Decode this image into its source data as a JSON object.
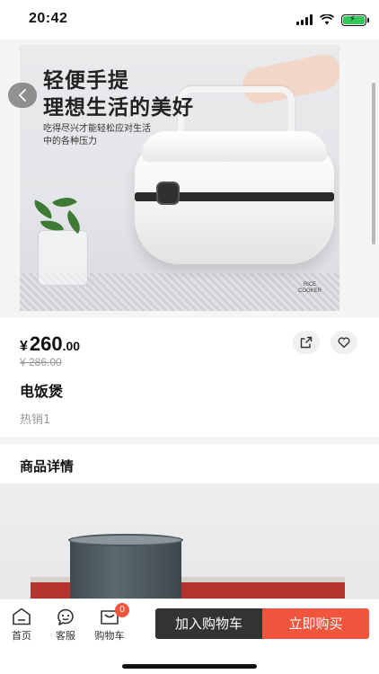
{
  "status_bar": {
    "time": "20:42"
  },
  "hero": {
    "title_line1": "轻便手提",
    "title_line2": "理想生活的美好",
    "subtitle_line1": "吃得尽兴才能轻松应对生活",
    "subtitle_line2": "中的各种压力",
    "corner_label_1": "RICE",
    "corner_label_2": "COOKER"
  },
  "product": {
    "currency": "¥",
    "price_int": "260",
    "price_dec": ".00",
    "old_price": "¥ 286.00",
    "title": "电饭煲",
    "sales": "热销1"
  },
  "detail": {
    "title": "商品详情"
  },
  "bottom_nav": {
    "home": "首页",
    "service": "客服",
    "cart": "购物车",
    "cart_badge": "0",
    "add_to_cart": "加入购物车",
    "buy_now": "立即购买"
  },
  "colors": {
    "accent": "#f2553d",
    "dark_button": "#333333",
    "muted": "#999999"
  },
  "icons": [
    "back-arrow-icon",
    "share-icon",
    "heart-icon",
    "home-icon",
    "service-icon",
    "cart-icon"
  ]
}
